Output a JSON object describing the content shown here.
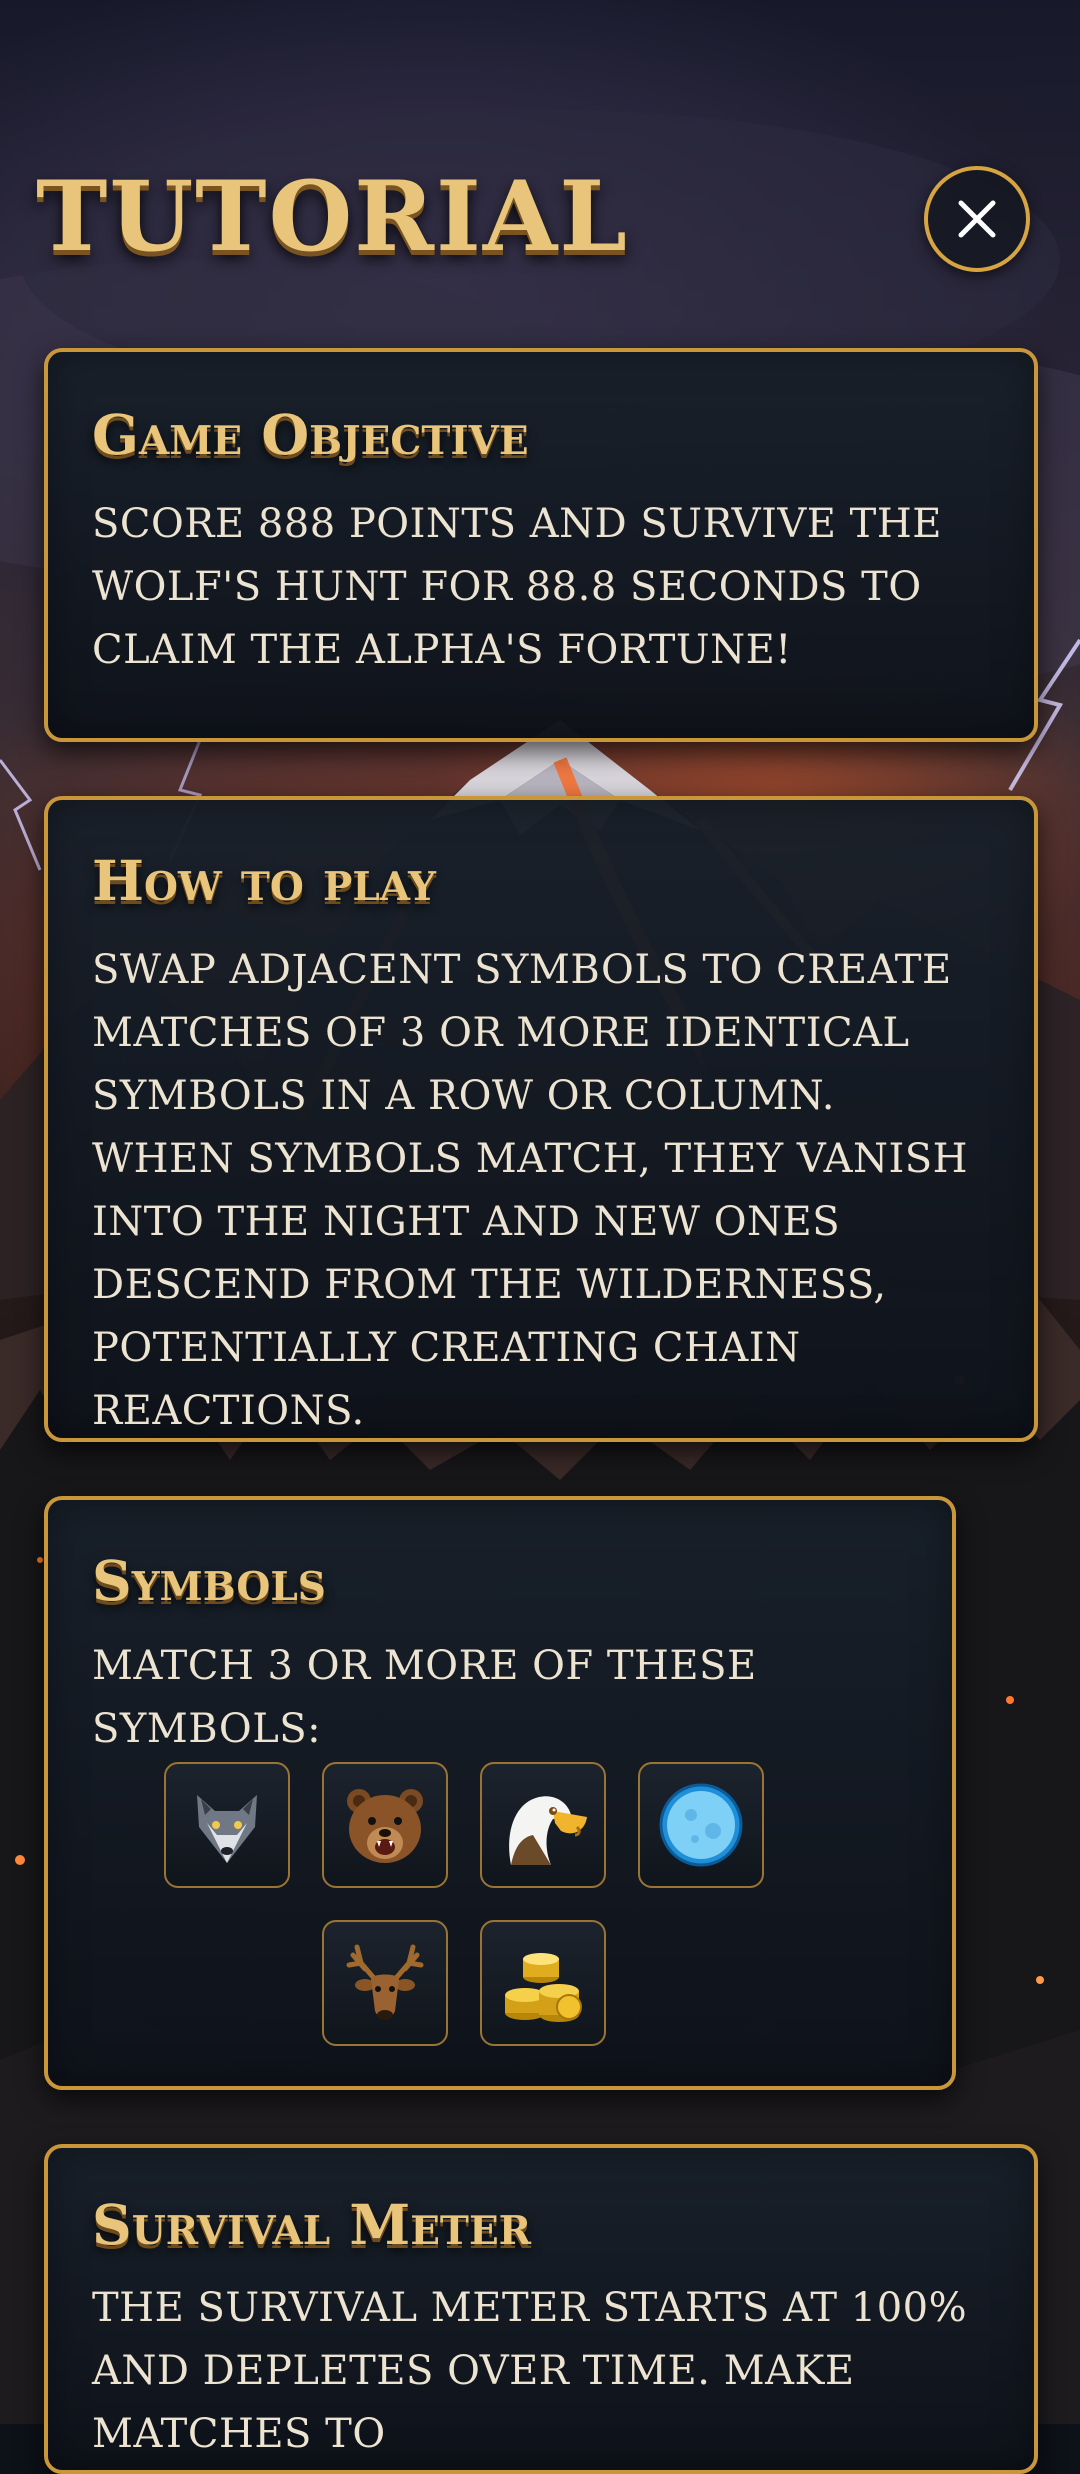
{
  "screen": {
    "title": "TUTORIAL",
    "close_icon": "close-x-icon"
  },
  "sections": {
    "objective": {
      "heading": "Game Objective",
      "body": "Score 888 points and survive the wolf's hunt for 88.8 seconds to claim the alpha's fortune!"
    },
    "how_to_play": {
      "heading": "How to play",
      "body": "Swap adjacent symbols to create matches of 3 or more identical symbols in a row or column. When symbols match, they vanish into the night and new ones descend from the wilderness, potentially creating chain reactions."
    },
    "symbols": {
      "heading": "Symbols",
      "intro": "Match 3 or more of these symbols:",
      "items": [
        "wolf-icon",
        "bear-icon",
        "eagle-icon",
        "moon-icon",
        "deer-icon",
        "gold-coins-icon"
      ]
    },
    "survival_meter": {
      "heading": "Survival Meter",
      "body": "The survival meter starts at 100% and depletes over time. Make matches to"
    }
  },
  "colors": {
    "accent_gold": "#e8c57a",
    "border_gold": "#c9963a",
    "panel_bg": "#141b24",
    "body_text": "#ece3d0"
  }
}
